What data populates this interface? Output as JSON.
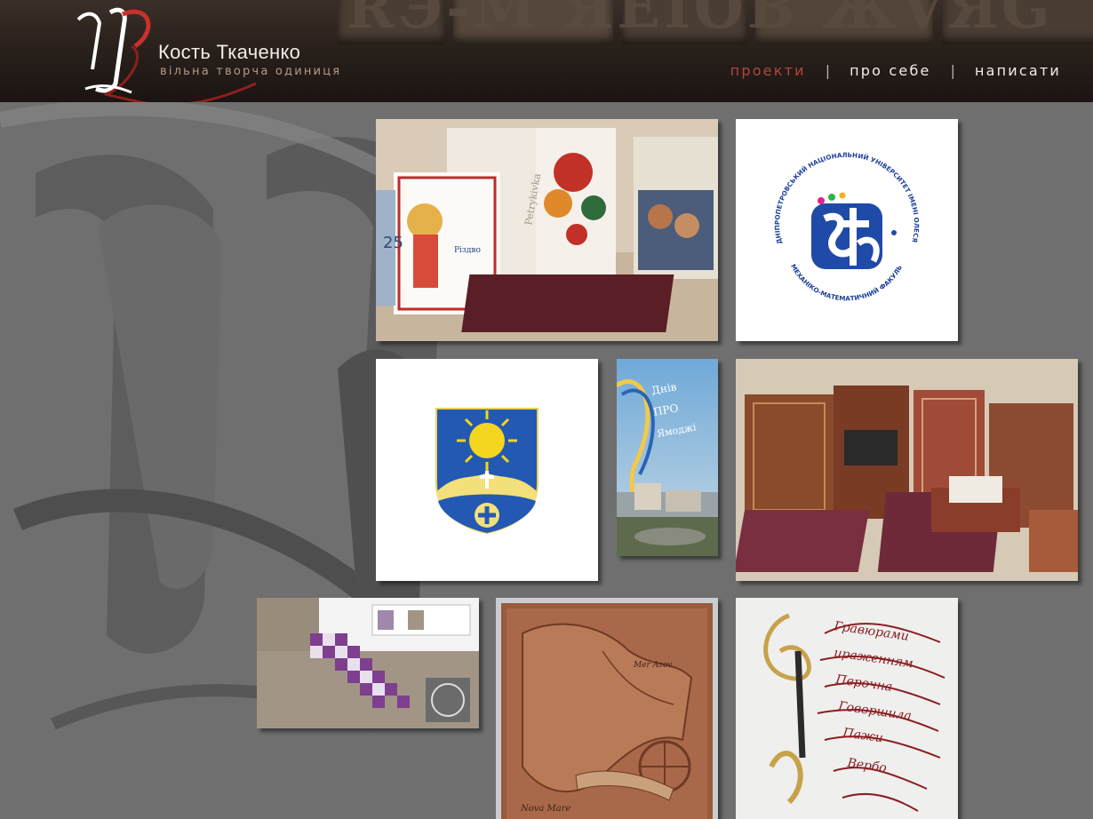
{
  "header": {
    "brand_name": "Кость Ткаченко",
    "brand_subtitle": "вільна творча одиниця",
    "nav": [
      {
        "label": "проекти",
        "active": true
      },
      {
        "label": "про себе",
        "active": false
      },
      {
        "label": "написати",
        "active": false
      }
    ],
    "separator": "|"
  },
  "tiles": {
    "books": {
      "spine_text": "Petrykivka"
    },
    "univ": {
      "arc_top": "ДНІПРОПЕТРОВСЬКИЙ НАЦІОНАЛЬНИЙ УНІВЕРСИТЕТ ІМЕНІ ОЛЕСЯ ГОНЧАРА",
      "arc_bottom": "МЕХАНІКО-МАТЕМАТИЧНИЙ ФАКУЛЬТЕТ"
    },
    "map": {
      "label_left": "Nova Mare",
      "label_right": "Mer Azov"
    }
  },
  "colors": {
    "background": "#6f6f6f",
    "accent": "#b3473a",
    "header": "#2a211c"
  }
}
